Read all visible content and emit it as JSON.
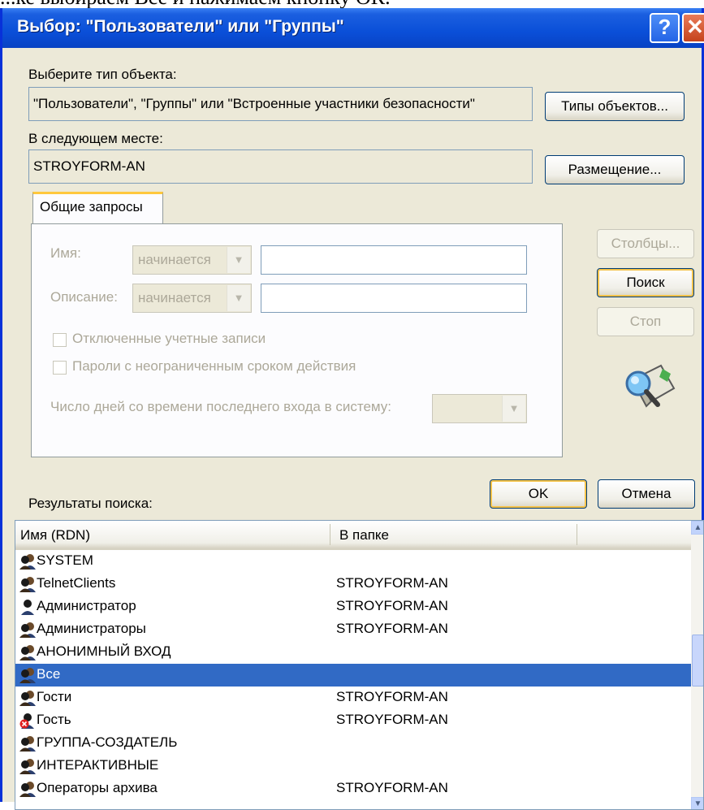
{
  "caption": "...ке выбираем Все и нажимаем кнопку ОК.",
  "window": {
    "title": "Выбор: \"Пользователи\" или \"Группы\"",
    "help_glyph": "?",
    "close_glyph": "✕"
  },
  "object_type": {
    "label": "Выберите тип объекта:",
    "value": "\"Пользователи\", \"Группы\" или \"Встроенные участники безопасности\"",
    "button": "Типы объектов..."
  },
  "location": {
    "label": "В следующем месте:",
    "value": "STROYFORM-AN",
    "button": "Размещение..."
  },
  "query": {
    "tab": "Общие запросы",
    "name_label": "Имя:",
    "name_mode": "начинается",
    "desc_label": "Описание:",
    "desc_mode": "начинается",
    "disabled_accounts": "Отключенные учетные записи",
    "non_expiring": "Пароли с неограниченным сроком действия",
    "days_label": "Число дней со времени последнего входа в систему:"
  },
  "side_buttons": {
    "columns": "Столбцы...",
    "search": "Поиск",
    "stop": "Стоп"
  },
  "footer": {
    "ok": "OK",
    "cancel": "Отмена",
    "results_label": "Результаты поиска:"
  },
  "results": {
    "columns": [
      "Имя (RDN)",
      "В папке"
    ],
    "rows": [
      {
        "name": "SYSTEM",
        "folder": "",
        "icon": "group-icon"
      },
      {
        "name": "TelnetClients",
        "folder": "STROYFORM-AN",
        "icon": "group-icon"
      },
      {
        "name": "Администратор",
        "folder": "STROYFORM-AN",
        "icon": "user-icon"
      },
      {
        "name": "Администраторы",
        "folder": "STROYFORM-AN",
        "icon": "group-icon"
      },
      {
        "name": "АНОНИМНЫЙ ВХОД",
        "folder": "",
        "icon": "group-icon"
      },
      {
        "name": "Все",
        "folder": "",
        "icon": "group-icon",
        "selected": true
      },
      {
        "name": "Гости",
        "folder": "STROYFORM-AN",
        "icon": "group-icon"
      },
      {
        "name": "Гость",
        "folder": "STROYFORM-AN",
        "icon": "disabled-user-icon"
      },
      {
        "name": "ГРУППА-СОЗДАТЕЛЬ",
        "folder": "",
        "icon": "group-icon"
      },
      {
        "name": "ИНТЕРАКТИВНЫЕ",
        "folder": "",
        "icon": "group-icon"
      },
      {
        "name": "Операторы архива",
        "folder": "STROYFORM-AN",
        "icon": "group-icon"
      }
    ]
  },
  "colors": {
    "selection": "#316ac5",
    "title_bar": "#0a4fd8",
    "dialog_bg": "#ece9d8"
  }
}
